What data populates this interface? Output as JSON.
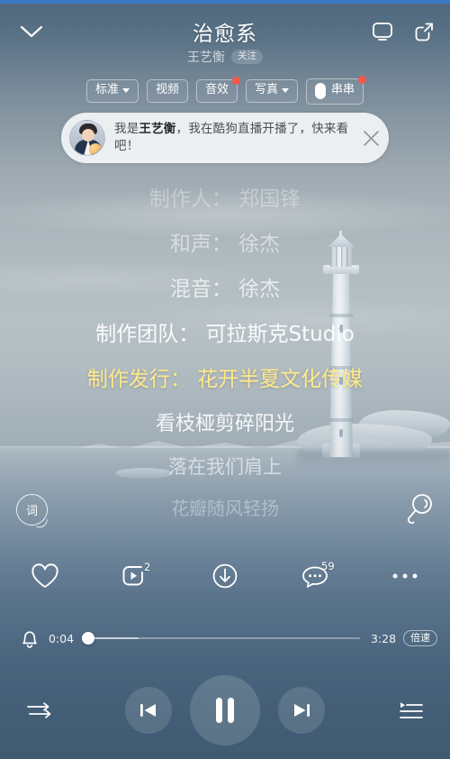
{
  "header": {
    "title": "治愈系",
    "artist": "王艺衡",
    "follow_label": "关注",
    "back_icon": "chevron-down-icon",
    "cast_icon": "monitor-cast-icon",
    "share_icon": "share-icon"
  },
  "tags": [
    {
      "label": "标准",
      "has_caret": true,
      "has_dot": false,
      "has_pill": false
    },
    {
      "label": "视频",
      "has_caret": false,
      "has_dot": false,
      "has_pill": false
    },
    {
      "label": "音效",
      "has_caret": false,
      "has_dot": true,
      "has_pill": false
    },
    {
      "label": "写真",
      "has_caret": true,
      "has_dot": false,
      "has_pill": false
    },
    {
      "label": "串串",
      "has_caret": false,
      "has_dot": true,
      "has_pill": true
    }
  ],
  "banner": {
    "text_before": "我是",
    "text_bold": "王艺衡",
    "text_after": "，我在酷狗直播开播了，快来看吧！",
    "avatar_name": "live-streamer-avatar",
    "close_icon": "close-icon"
  },
  "lyrics": {
    "lines": [
      "制作人： 郑国锋",
      "和声： 徐杰",
      "混音： 徐杰",
      "制作团队： 可拉斯克Studio",
      "制作发行： 花开半夏文化传媒",
      "看枝桠剪碎阳光",
      "落在我们肩上",
      "花瓣随风轻扬"
    ],
    "active_index": 4,
    "active_color": "#ffe98a"
  },
  "side_badges": {
    "lyric_badge_label": "词",
    "mic_icon": "microphone-icon"
  },
  "actions": [
    {
      "name": "favorite",
      "icon": "heart-icon",
      "badge": ""
    },
    {
      "name": "mv",
      "icon": "mv-play-icon",
      "badge": "2"
    },
    {
      "name": "download",
      "icon": "download-icon",
      "badge": ""
    },
    {
      "name": "comment",
      "icon": "comment-icon",
      "badge": "59"
    },
    {
      "name": "more",
      "icon": "more-dots-icon",
      "badge": ""
    }
  ],
  "progress": {
    "alarm_icon": "bell-icon",
    "current_time": "0:04",
    "total_time": "3:28",
    "speed_label": "倍速",
    "percent": 2,
    "buffered_percent": 20
  },
  "controls": {
    "mode_icon": "play-order-icon",
    "prev_icon": "previous-icon",
    "play_icon": "pause-icon",
    "next_icon": "next-icon",
    "playlist_icon": "playlist-icon"
  },
  "colors": {
    "accent_yellow": "#ffe98a",
    "badge_red": "#f4584c",
    "status_blue": "#3c78c8",
    "bg_deep": "#4b6679"
  }
}
